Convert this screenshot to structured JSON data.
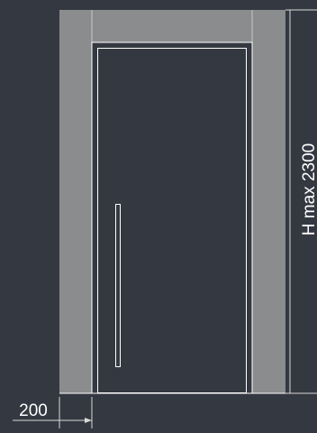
{
  "dimensions": {
    "height_label": "H max 2300",
    "wall_width_label": "200"
  },
  "colors": {
    "background": "#343841",
    "wall_fill": "#8a8c8e",
    "line": "#ffffff",
    "dimension_line": "#d8d8d8"
  }
}
